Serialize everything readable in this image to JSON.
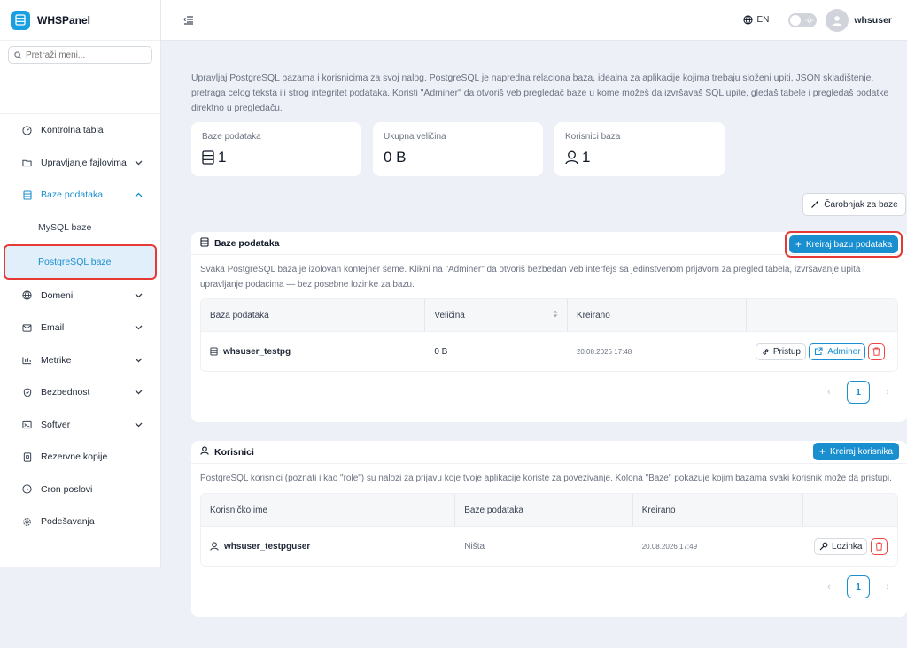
{
  "app": {
    "name": "WHSPanel"
  },
  "sidebar": {
    "search_placeholder": "Pretraži meni...",
    "items": [
      {
        "label": "Kontrolna tabla",
        "icon": "dashboard-icon"
      },
      {
        "label": "Upravljanje fajlovima",
        "icon": "folder-icon"
      },
      {
        "label": "Baze podataka",
        "icon": "database-icon"
      },
      {
        "label": "MySQL baze"
      },
      {
        "label": "PostgreSQL baze"
      },
      {
        "label": "Domeni",
        "icon": "globe-icon"
      },
      {
        "label": "Email",
        "icon": "mail-icon"
      },
      {
        "label": "Metrike",
        "icon": "chart-icon"
      },
      {
        "label": "Bezbednost",
        "icon": "shield-icon"
      },
      {
        "label": "Softver",
        "icon": "terminal-icon"
      },
      {
        "label": "Rezervne kopije",
        "icon": "backup-icon"
      },
      {
        "label": "Cron poslovi",
        "icon": "clock-icon"
      },
      {
        "label": "Podešavanja",
        "icon": "gear-icon"
      }
    ]
  },
  "topbar": {
    "lang": "EN",
    "username": "whsuser"
  },
  "intro": "Upravljaj PostgreSQL bazama i korisnicima za svoj nalog. PostgreSQL je napredna relaciona baza, idealna za aplikacije kojima trebaju složeni upiti, JSON skladištenje, pretraga celog teksta ili strog integritet podataka. Koristi \"Adminer\" da otvoriš veb pregledač baze u kome možeš da izvršavaš SQL upite, gledaš tabele i pregledaš podatke direktno u pregledaču.",
  "stats": [
    {
      "label": "Baze podataka",
      "value": "1"
    },
    {
      "label": "Ukupna veličina",
      "value": "0 B"
    },
    {
      "label": "Korisnici baza",
      "value": "1"
    }
  ],
  "wizard_label": "Čarobnjak za baze",
  "databases": {
    "title": "Baze podataka",
    "create_label": "Kreiraj bazu podataka",
    "description": "Svaka PostgreSQL baza je izolovan kontejner šeme. Klikni na \"Adminer\" da otvoriš bezbedan veb interfejs sa jedinstvenom prijavom za pregled tabela, izvršavanje upita i upravljanje podacima — bez posebne lozinke za bazu.",
    "columns": [
      "Baza podataka",
      "Veličina",
      "Kreirano"
    ],
    "rows": [
      {
        "name": "whsuser_testpg",
        "size": "0 B",
        "created": "20.08.2026 17:48",
        "access_label": "Pristup",
        "adminer_label": "Adminer"
      }
    ],
    "page": "1"
  },
  "users": {
    "title": "Korisnici",
    "create_label": "Kreiraj korisnika",
    "description": "PostgreSQL korisnici (poznati i kao \"role\") su nalozi za prijavu koje tvoje aplikacije koriste za povezivanje. Kolona \"Baze\" pokazuje kojim bazama svaki korisnik može da pristupi.",
    "columns": [
      "Korisničko ime",
      "Baze podataka",
      "Kreirano"
    ],
    "rows": [
      {
        "name": "whsuser_testpguser",
        "databases": "Ništa",
        "created": "20.08.2026 17:49",
        "password_label": "Lozinka"
      }
    ],
    "page": "1"
  },
  "colors": {
    "accent": "#1a8fd0",
    "danger": "#ef4444",
    "highlight": "#e53935"
  }
}
